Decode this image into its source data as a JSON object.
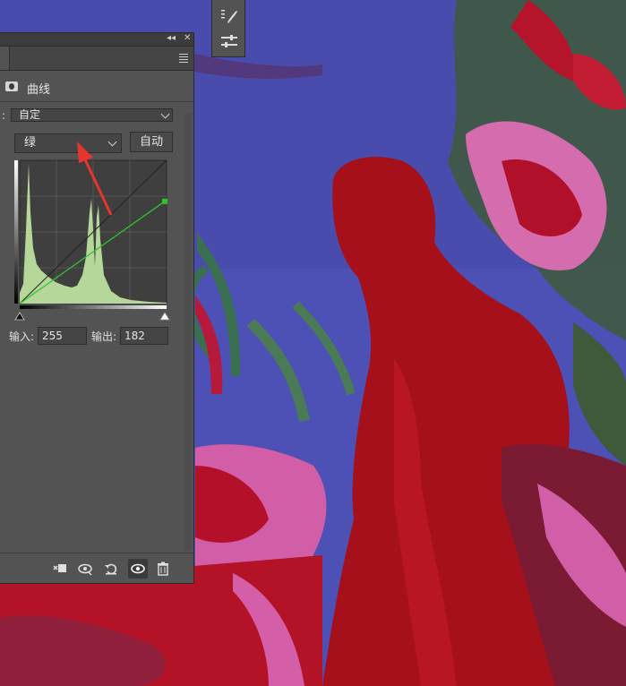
{
  "panel": {
    "title": "曲线",
    "preset_label": ":",
    "preset_value": "自定",
    "channel_value": "绿",
    "auto_label": "自动",
    "input_label": "输入:",
    "input_value": "255",
    "output_label": "输出:",
    "output_value": "182",
    "collapse_glyph": "◂◂",
    "close_glyph": "✕"
  },
  "curve": {
    "channel_color": "#2fc42f",
    "histogram_color": "#b6d79a",
    "input": 255,
    "output": 182
  },
  "colors": {
    "panel_bg": "#535353",
    "canvas_blue": "#4a4fb0",
    "figure_red": "#a5101a",
    "flower_pink": "#d96fb0",
    "annotation_arrow": "#e8352b"
  },
  "icons": {
    "tool_strip": [
      "brush-settings-icon",
      "adjustments-icon"
    ],
    "bottom": [
      "clip-to-layer-icon",
      "view-previous-state-icon",
      "reset-icon",
      "visibility-eye-icon",
      "trash-icon"
    ]
  }
}
